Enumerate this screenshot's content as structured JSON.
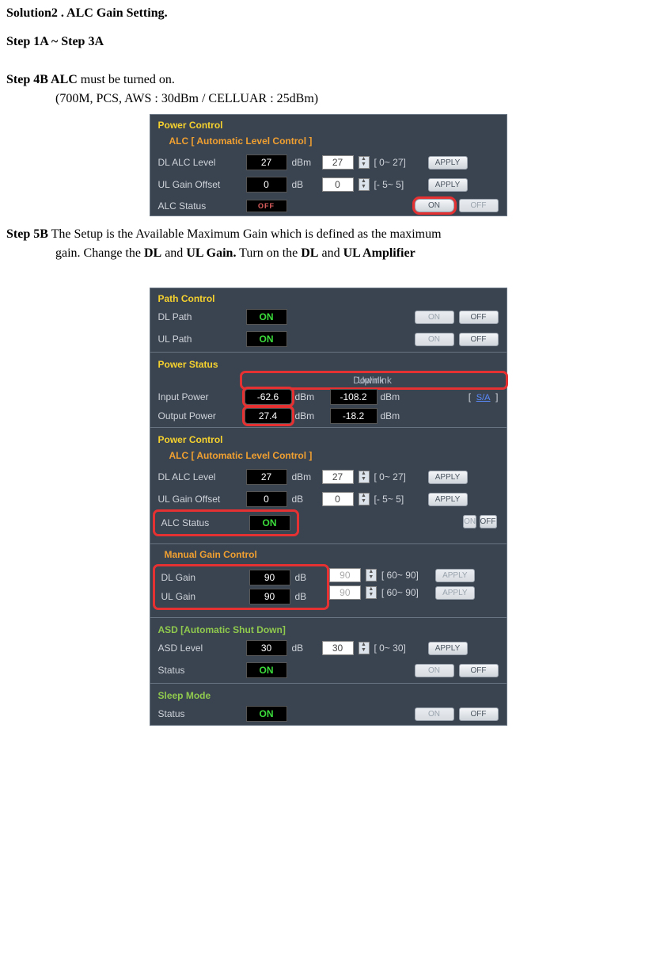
{
  "doc": {
    "title": "Solution2 . ALC Gain Setting.",
    "step1to3": "Step 1A ~ Step 3A",
    "step4b_label": "Step 4B ALC",
    "step4b_text": " must be turned on.",
    "step4b_sub": "(700M, PCS, AWS : 30dBm / CELLUAR : 25dBm)",
    "step5b_label": "Step 5B",
    "step5b_text1": " The Setup is the Available Maximum Gain which is defined as the maximum",
    "step5b_text2a": "gain. Change the ",
    "step5b_dl": "DL",
    "step5b_and1": " and ",
    "step5b_ulgain": "UL Gain.",
    "step5b_turn": " Turn on the ",
    "step5b_dl2": "DL",
    "step5b_and2": " and ",
    "step5b_ulamp": "UL Amplifier"
  },
  "common": {
    "apply": "APPLY",
    "on": "ON",
    "off": "OFF"
  },
  "panel1": {
    "hdr1": "Power Control",
    "hdr2": "ALC [ Automatic Level Control ]",
    "r1": {
      "label": "DL ALC Level",
      "val": "27",
      "unit": "dBm",
      "input": "27",
      "range": "[ 0~ 27]"
    },
    "r2": {
      "label": "UL Gain Offset",
      "val": "0",
      "unit": "dB",
      "input": "0",
      "range": "[- 5~  5]"
    },
    "r3": {
      "label": "ALC Status",
      "val": "OFF"
    }
  },
  "panel2": {
    "path": {
      "hdr": "Path Control",
      "r1": {
        "label": "DL Path",
        "val": "ON"
      },
      "r2": {
        "label": "UL Path",
        "val": "ON"
      }
    },
    "pstatus": {
      "hdr": "Power Status",
      "col1": "Downlink",
      "col2": "Uplink",
      "r1": {
        "label": "Input Power",
        "v1": "-62.6",
        "u1": "dBm",
        "v2": "-108.2",
        "u2": "dBm",
        "link": "S/A"
      },
      "r2": {
        "label": "Output Power",
        "v1": "27.4",
        "u1": "dBm",
        "v2": "-18.2",
        "u2": "dBm"
      }
    },
    "pctrl": {
      "hdr1": "Power Control",
      "hdr2": "ALC [ Automatic Level Control ]",
      "r1": {
        "label": "DL ALC Level",
        "val": "27",
        "unit": "dBm",
        "input": "27",
        "range": "[ 0~ 27]"
      },
      "r2": {
        "label": "UL Gain Offset",
        "val": "0",
        "unit": "dB",
        "input": "0",
        "range": "[- 5~  5]"
      },
      "r3": {
        "label": "ALC Status",
        "val": "ON"
      }
    },
    "mgain": {
      "hdr": "Manual Gain Control",
      "r1": {
        "label": "DL Gain",
        "val": "90",
        "unit": "dB",
        "input": "90",
        "range": "[ 60~ 90]"
      },
      "r2": {
        "label": "UL Gain",
        "val": "90",
        "unit": "dB",
        "input": "90",
        "range": "[ 60~ 90]"
      }
    },
    "asd": {
      "hdr": "ASD [Automatic Shut Down]",
      "r1": {
        "label": "ASD Level",
        "val": "30",
        "unit": "dB",
        "input": "30",
        "range": "[ 0~ 30]"
      },
      "r2": {
        "label": "Status",
        "val": "ON"
      }
    },
    "sleep": {
      "hdr": "Sleep Mode",
      "r1": {
        "label": "Status",
        "val": "ON"
      }
    }
  }
}
